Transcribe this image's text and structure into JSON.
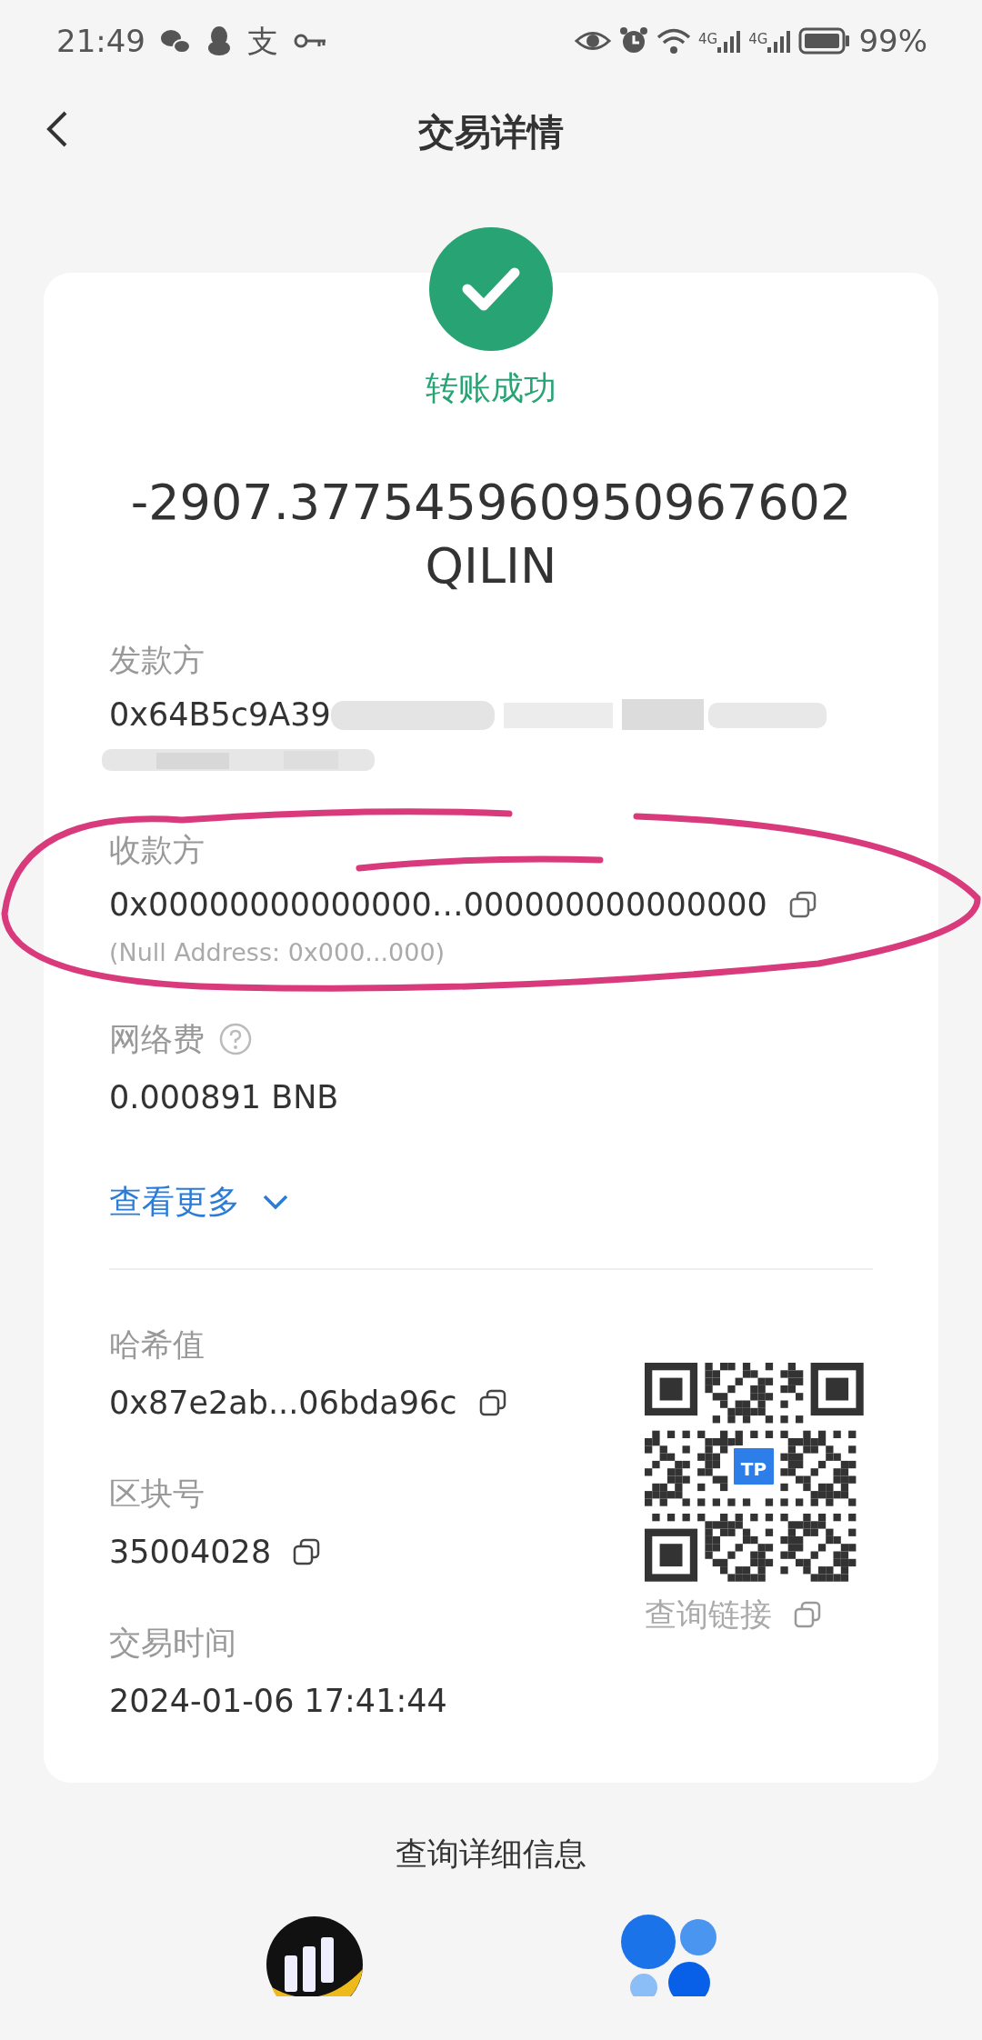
{
  "status_bar": {
    "time": "21:49",
    "app_glyph": "支",
    "network_1": "4G",
    "network_2": "4G",
    "battery": "99%"
  },
  "header": {
    "title": "交易详情"
  },
  "result": {
    "kind": "success",
    "text": "转账成功"
  },
  "amount": {
    "value": "-2907.377545960950967602",
    "unit": "QILIN"
  },
  "sender": {
    "label": "发款方",
    "address": "0x64B5c9A39",
    "redacted": true
  },
  "recipient": {
    "label": "收款方",
    "address": "0x00000000000000…000000000000000",
    "note": "(Null Address: 0x000...000)"
  },
  "fee": {
    "label": "网络费",
    "value": "0.000891 BNB"
  },
  "more": {
    "label": "查看更多",
    "expanded": false
  },
  "hash": {
    "label": "哈希值",
    "value": "0x87e2ab...06bda96c"
  },
  "block": {
    "label": "区块号",
    "value": "35004028"
  },
  "time": {
    "label": "交易时间",
    "value": "2024-01-06 17:41:44"
  },
  "qr": {
    "badge": "TP",
    "link_label": "查询链接"
  },
  "footer": {
    "title": "查询详细信息"
  }
}
